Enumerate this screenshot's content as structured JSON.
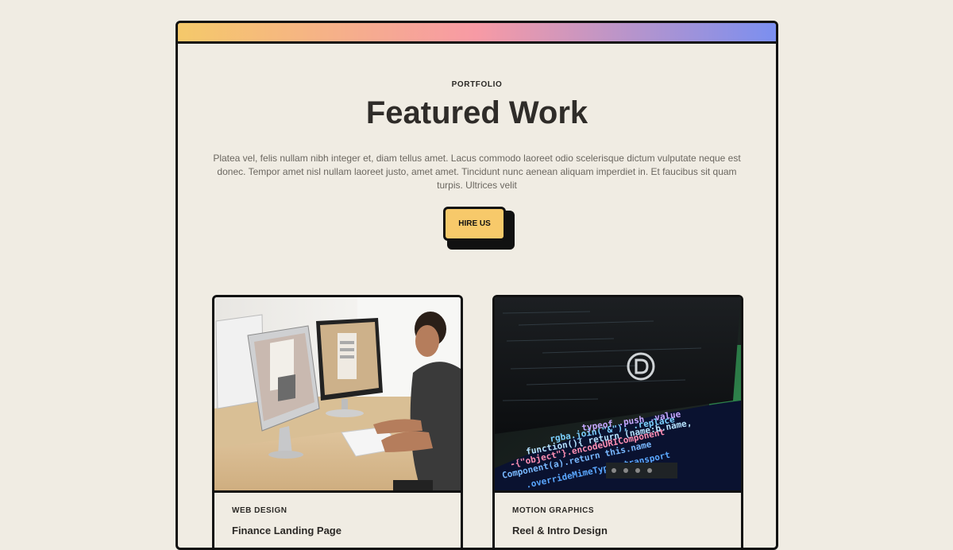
{
  "colors": {
    "background": "#f0ece3",
    "border": "#111111",
    "button": "#f7c96a",
    "gradient": [
      "#f5c96a",
      "#f79aa5",
      "#7b8ff0"
    ]
  },
  "header": {
    "eyebrow": "PORTFOLIO",
    "title": "Featured Work",
    "description": "Platea vel, felis nullam nibh integer et, diam tellus amet. Lacus commodo laoreet odio scelerisque dictum vulputate neque est donec. Tempor amet nisl nullam laoreet justo, amet amet. Tincidunt nunc aenean aliquam imperdiet in. Et faucibus sit quam turpis. Ultrices velit",
    "cta_label": "HIRE US"
  },
  "cards": [
    {
      "category": "WEB DESIGN",
      "title": "Finance Landing Page",
      "image": "man-at-desktop-computers-photo"
    },
    {
      "category": "MOTION GRAPHICS",
      "title": "Reel & Intro Design",
      "image": "code-screen-with-divi-logo-photo"
    }
  ]
}
